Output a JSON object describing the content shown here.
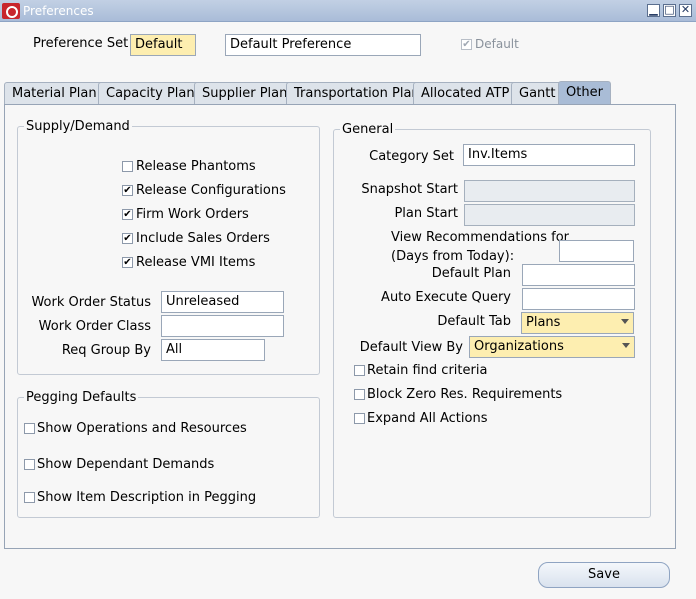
{
  "window": {
    "title": "Preferences",
    "minimize_glyph": "▁",
    "maximize_glyph": "□",
    "close_glyph": "✕"
  },
  "header": {
    "pref_set_label": "Preference Set",
    "pref_set_value": "Default",
    "pref_desc_value": "Default Preference",
    "default_checkbox_label": "Default",
    "default_checked": true
  },
  "tabs": [
    {
      "label": "Material Plan"
    },
    {
      "label": "Capacity Plan"
    },
    {
      "label": "Supplier Plan"
    },
    {
      "label": "Transportation Plan"
    },
    {
      "label": "Allocated ATP"
    },
    {
      "label": "Gantt"
    },
    {
      "label": "Other",
      "active": true
    }
  ],
  "supply_demand": {
    "title": "Supply/Demand",
    "checks": [
      {
        "label": "Release Phantoms",
        "checked": false
      },
      {
        "label": "Release Configurations",
        "checked": true
      },
      {
        "label": "Firm Work Orders",
        "checked": true
      },
      {
        "label": "Include Sales Orders",
        "checked": true
      },
      {
        "label": "Release VMI Items",
        "checked": true
      }
    ],
    "work_order_status_label": "Work Order Status",
    "work_order_status_value": "Unreleased",
    "work_order_class_label": "Work Order Class",
    "work_order_class_value": "",
    "req_group_by_label": "Req Group By",
    "req_group_by_value": "All"
  },
  "pegging": {
    "title": "Pegging Defaults",
    "checks": [
      {
        "label": "Show Operations and Resources",
        "checked": false
      },
      {
        "label": "Show Dependant Demands",
        "checked": false
      },
      {
        "label": "Show Item Description in Pegging",
        "checked": false
      }
    ]
  },
  "general": {
    "title": "General",
    "category_set_label": "Category Set",
    "category_set_value": "Inv.Items",
    "snapshot_start_label": "Snapshot Start",
    "plan_start_label": "Plan Start",
    "view_recs_label_1": "View Recommendations for",
    "view_recs_label_2": "(Days from Today):",
    "default_plan_label": "Default Plan",
    "auto_execute_label": "Auto Execute Query",
    "default_tab_label": "Default Tab",
    "default_tab_value": "Plans",
    "default_view_by_label": "Default View By",
    "default_view_by_value": "Organizations",
    "checks": [
      {
        "label": "Retain find criteria",
        "checked": false
      },
      {
        "label": "Block Zero Res. Requirements",
        "checked": false
      },
      {
        "label": "Expand All Actions",
        "checked": false
      }
    ]
  },
  "footer": {
    "save_label": "Save"
  },
  "colors": {
    "accent": "#a9bcd6",
    "required_field": "#fdeeb0",
    "titlebar": "#b6c6de"
  }
}
